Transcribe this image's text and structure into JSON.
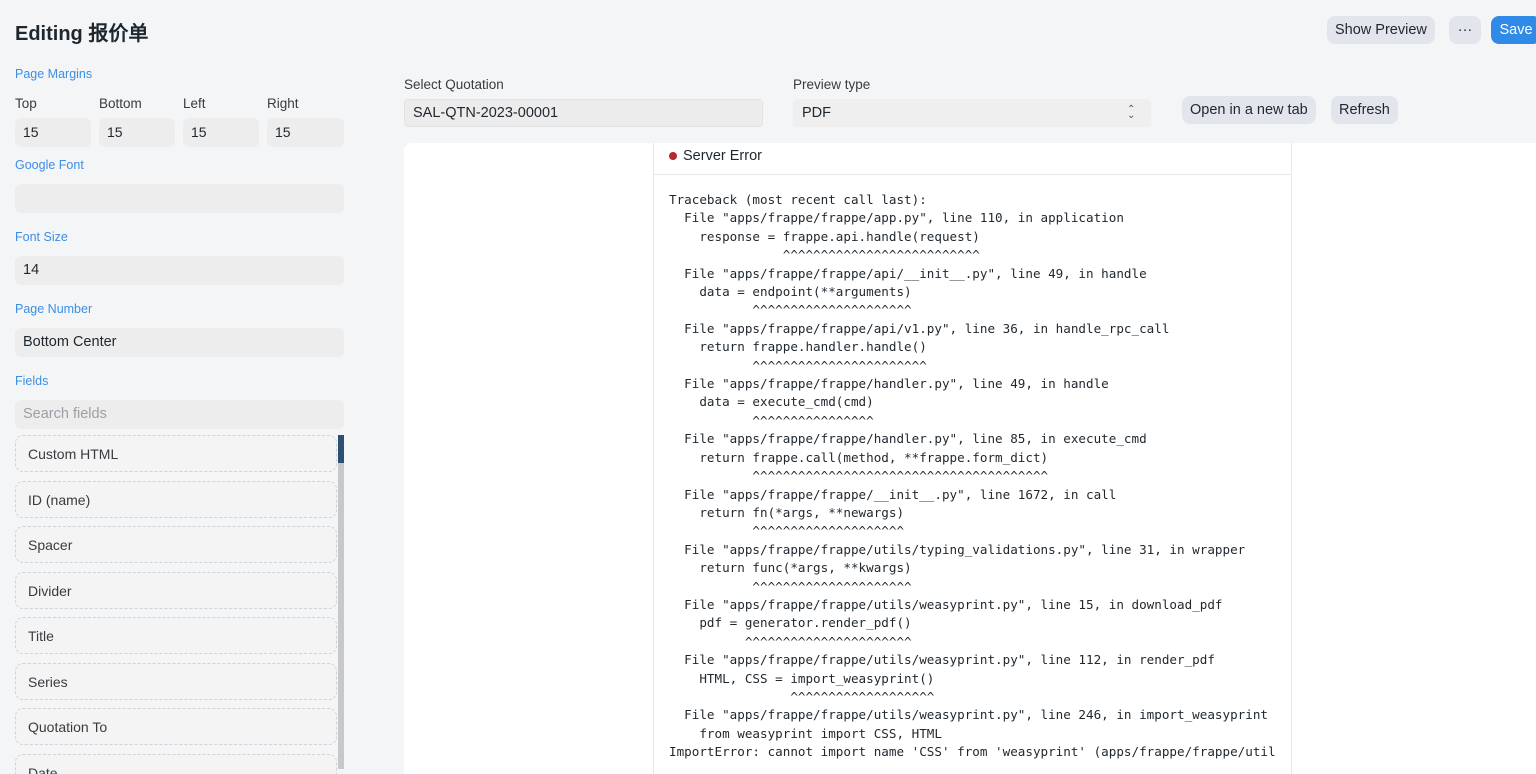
{
  "header": {
    "title": "Editing 报价单",
    "show_preview": "Show Preview",
    "more": "···",
    "save": "Save"
  },
  "sidebar": {
    "page_margins_label": "Page Margins",
    "margins": [
      {
        "label": "Top",
        "value": "15"
      },
      {
        "label": "Bottom",
        "value": "15"
      },
      {
        "label": "Left",
        "value": "15"
      },
      {
        "label": "Right",
        "value": "15"
      }
    ],
    "google_font_label": "Google Font",
    "google_font_value": "",
    "font_size_label": "Font Size",
    "font_size_value": "14",
    "page_number_label": "Page Number",
    "page_number_value": "Bottom Center",
    "fields_label": "Fields",
    "search_placeholder": "Search fields",
    "fields": [
      "Custom HTML",
      "ID (name)",
      "Spacer",
      "Divider",
      "Title",
      "Series",
      "Quotation To",
      "Date"
    ]
  },
  "preview": {
    "select_quotation_label": "Select Quotation",
    "select_quotation_value": "SAL-QTN-2023-00001",
    "preview_type_label": "Preview type",
    "preview_type_value": "PDF",
    "open_new_tab": "Open in a new tab",
    "refresh": "Refresh"
  },
  "error": {
    "title": "Server Error",
    "traceback": "Traceback (most recent call last):\n  File \"apps/frappe/frappe/app.py\", line 110, in application\n    response = frappe.api.handle(request)\n               ^^^^^^^^^^^^^^^^^^^^^^^^^^\n  File \"apps/frappe/frappe/api/__init__.py\", line 49, in handle\n    data = endpoint(**arguments)\n           ^^^^^^^^^^^^^^^^^^^^^\n  File \"apps/frappe/frappe/api/v1.py\", line 36, in handle_rpc_call\n    return frappe.handler.handle()\n           ^^^^^^^^^^^^^^^^^^^^^^^\n  File \"apps/frappe/frappe/handler.py\", line 49, in handle\n    data = execute_cmd(cmd)\n           ^^^^^^^^^^^^^^^^\n  File \"apps/frappe/frappe/handler.py\", line 85, in execute_cmd\n    return frappe.call(method, **frappe.form_dict)\n           ^^^^^^^^^^^^^^^^^^^^^^^^^^^^^^^^^^^^^^^\n  File \"apps/frappe/frappe/__init__.py\", line 1672, in call\n    return fn(*args, **newargs)\n           ^^^^^^^^^^^^^^^^^^^^\n  File \"apps/frappe/frappe/utils/typing_validations.py\", line 31, in wrapper\n    return func(*args, **kwargs)\n           ^^^^^^^^^^^^^^^^^^^^^\n  File \"apps/frappe/frappe/utils/weasyprint.py\", line 15, in download_pdf\n    pdf = generator.render_pdf()\n          ^^^^^^^^^^^^^^^^^^^^^^\n  File \"apps/frappe/frappe/utils/weasyprint.py\", line 112, in render_pdf\n    HTML, CSS = import_weasyprint()\n                ^^^^^^^^^^^^^^^^^^^\n  File \"apps/frappe/frappe/utils/weasyprint.py\", line 246, in import_weasyprint\n    from weasyprint import CSS, HTML\nImportError: cannot import name 'CSS' from 'weasyprint' (apps/frappe/frappe/util"
  },
  "colors": {
    "accent": "#2f8ae8",
    "section_label": "#3c8ee6",
    "error_dot": "#b52a2a",
    "scroll_thumb": "#2d4f73"
  }
}
